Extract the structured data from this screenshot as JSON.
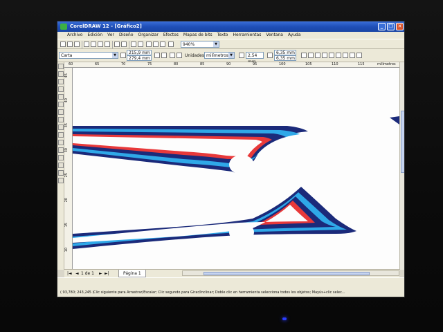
{
  "window": {
    "title": "CorelDRAW 12 - [Gráfico2]",
    "buttons": {
      "minimize": "_",
      "restore": "❐",
      "close": "✕"
    }
  },
  "menu": [
    "Archivo",
    "Edición",
    "Ver",
    "Diseño",
    "Organizar",
    "Efectos",
    "Mapas de bits",
    "Texto",
    "Herramientas",
    "Ventana",
    "Ayuda"
  ],
  "toolbar": {
    "zoom_value": "940%"
  },
  "property_bar": {
    "paper_size": "Carta",
    "width": "215,9 mm",
    "height": "279,4 mm",
    "units_label": "Unidades:",
    "units_value": "milímetros",
    "nudge": "2,54 mm",
    "dup_x": "6,35 mm",
    "dup_y": "6,35 mm"
  },
  "ruler": {
    "h_labels": [
      "60",
      "65",
      "70",
      "75",
      "80",
      "85",
      "90",
      "95",
      "100",
      "105",
      "110",
      "115"
    ],
    "unit": "milímetros",
    "v_labels": [
      "45",
      "40",
      "35",
      "30",
      "25",
      "20",
      "15",
      "10"
    ]
  },
  "pages": {
    "count_text": "1 de 1",
    "tab_label": "Página 1"
  },
  "status": {
    "coords": "( 93,780; 243,245 )",
    "message": "Clic siguiente para Arrastrar/Escalar; Clic segundo para Girar/Inclinar; Doble clic en herramienta selecciona todos los objetos; Mayús+clic selec..."
  },
  "colors": {
    "navy": "#1b2a7a",
    "light_blue": "#2fa8e8",
    "red": "#e8393a",
    "titlebar": "#1f4fb8"
  }
}
